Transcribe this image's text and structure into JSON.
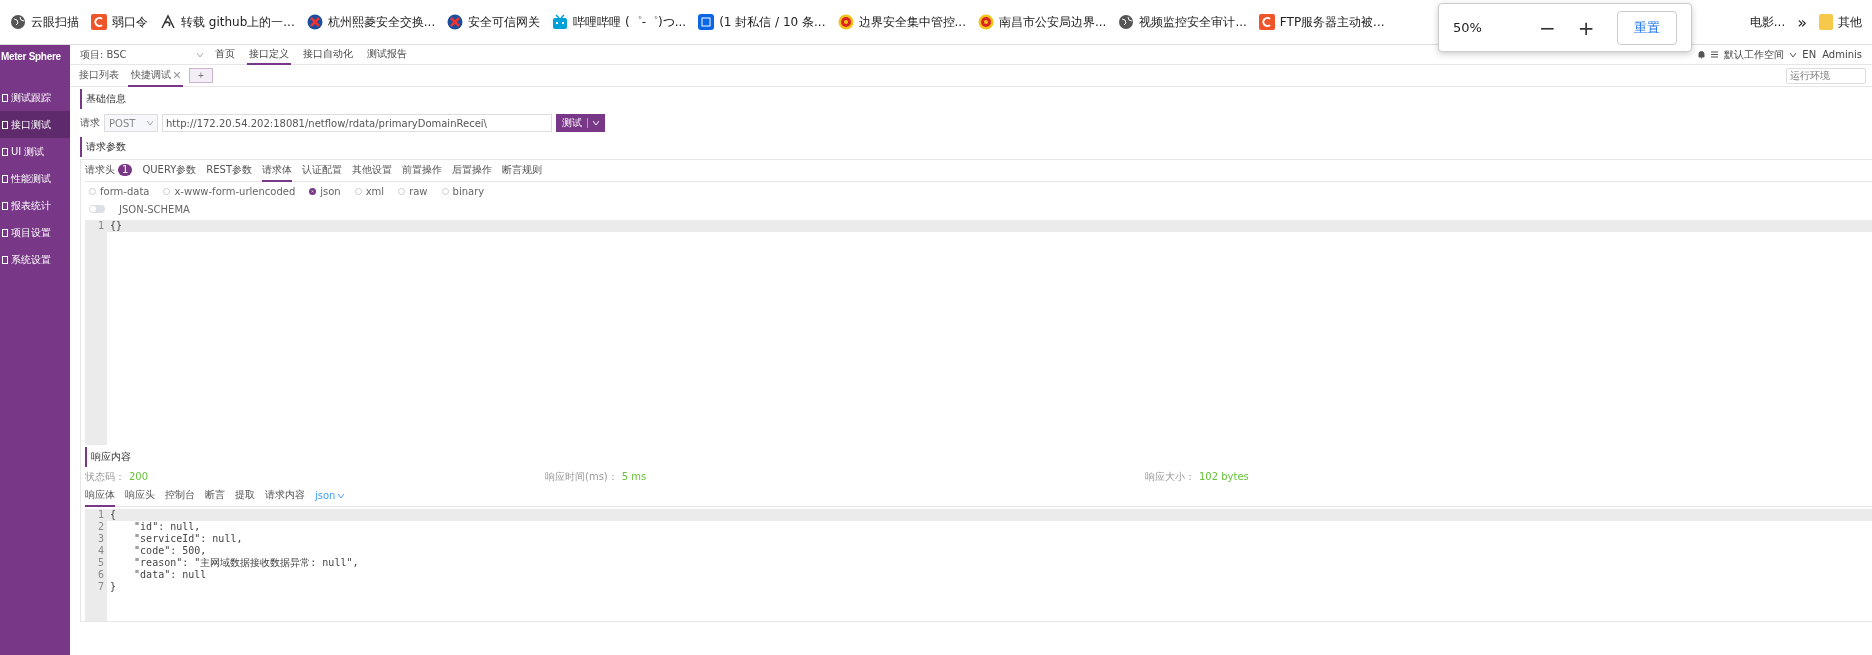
{
  "browser": {
    "bookmarks": [
      {
        "label": "云眼扫描",
        "kind": "globe"
      },
      {
        "label": "弱口令",
        "kind": "c"
      },
      {
        "label": "转载 github上的一...",
        "kind": "swirl"
      },
      {
        "label": "杭州熙菱安全交换...",
        "kind": "x"
      },
      {
        "label": "安全可信网关",
        "kind": "x"
      },
      {
        "label": "哔哩哔哩 (゜-゜)つ...",
        "kind": "tv"
      },
      {
        "label": "(1 封私信 / 10 条...",
        "kind": "square"
      },
      {
        "label": "边界安全集中管控...",
        "kind": "emblem"
      },
      {
        "label": "南昌市公安局边界...",
        "kind": "emblem"
      },
      {
        "label": "视频监控安全审计...",
        "kind": "globe"
      },
      {
        "label": "FTP服务器主动被...",
        "kind": "c"
      }
    ],
    "trailing": [
      {
        "label": "电影..."
      }
    ],
    "overflow": "»",
    "folder": "其他"
  },
  "zoom_popup": {
    "level": "50%",
    "decrease": "−",
    "increase": "+",
    "reset": "重置"
  },
  "sidebar": {
    "logo": "Meter Sphere",
    "items": [
      {
        "label": "测试跟踪",
        "selected": false
      },
      {
        "label": "接口测试",
        "selected": true
      },
      {
        "label": "UI 测试",
        "selected": false
      },
      {
        "label": "性能测试",
        "selected": false
      },
      {
        "label": "报表统计",
        "selected": false
      },
      {
        "label": "项目设置",
        "selected": false
      },
      {
        "label": "系统设置",
        "selected": false
      }
    ]
  },
  "header": {
    "project": "项目: BSC",
    "nav": [
      {
        "label": "首页",
        "selected": false
      },
      {
        "label": "接口定义",
        "selected": true
      },
      {
        "label": "接口自动化",
        "selected": false
      },
      {
        "label": "测试报告",
        "selected": false
      }
    ],
    "workspace": "默认工作空间",
    "language": "EN",
    "user": "Adminis"
  },
  "subtabs": {
    "items": [
      {
        "label": "接口列表",
        "selected": false,
        "closable": false
      },
      {
        "label": "快捷调试",
        "selected": true,
        "closable": true
      }
    ],
    "add": "+",
    "environment": {
      "placeholder": "运行环境"
    }
  },
  "basic": {
    "title": "基础信息",
    "request_label": "请求",
    "method": "POST",
    "url": "http://172.20.54.202:18081/netflow/rdata/primaryDomainRecei\\",
    "test_button": "测试"
  },
  "params": {
    "title": "请求参数",
    "tabs": [
      {
        "label": "请求头",
        "selected": false,
        "badge": "1"
      },
      {
        "label": "QUERY参数",
        "selected": false
      },
      {
        "label": "REST参数",
        "selected": false
      },
      {
        "label": "请求体",
        "selected": true
      },
      {
        "label": "认证配置",
        "selected": false
      },
      {
        "label": "其他设置",
        "selected": false
      },
      {
        "label": "前置操作",
        "selected": false
      },
      {
        "label": "后置操作",
        "selected": false
      },
      {
        "label": "断言规则",
        "selected": false
      }
    ],
    "body_types": [
      {
        "label": "form-data",
        "selected": false
      },
      {
        "label": "x-www-form-urlencoded",
        "selected": false
      },
      {
        "label": "json",
        "selected": true
      },
      {
        "label": "xml",
        "selected": false
      },
      {
        "label": "raw",
        "selected": false
      },
      {
        "label": "binary",
        "selected": false
      }
    ],
    "schema_toggle": {
      "label": "JSON-SCHEMA",
      "on": false
    },
    "editor": [
      {
        "num": "1",
        "text": "{}"
      }
    ]
  },
  "response": {
    "title": "响应内容",
    "status_label": "状态码：",
    "status": "200",
    "time_label": "响应时间(ms)：",
    "time": "5 ms",
    "size_label": "响应大小：",
    "size": "102 bytes",
    "tabs": [
      {
        "label": "响应体",
        "selected": true
      },
      {
        "label": "响应头",
        "selected": false
      },
      {
        "label": "控制台",
        "selected": false
      },
      {
        "label": "断言",
        "selected": false
      },
      {
        "label": "提取",
        "selected": false
      },
      {
        "label": "请求内容",
        "selected": false
      }
    ],
    "format": "json",
    "lines": [
      {
        "num": "1",
        "text": "{"
      },
      {
        "num": "2",
        "text": "    \"id\": null,"
      },
      {
        "num": "3",
        "text": "    \"serviceId\": null,"
      },
      {
        "num": "4",
        "text": "    \"code\": 500,"
      },
      {
        "num": "5",
        "text": "    \"reason\": \"主网域数据接收数据异常: null\","
      },
      {
        "num": "6",
        "text": "    \"data\": null"
      },
      {
        "num": "7",
        "text": "}"
      }
    ]
  }
}
